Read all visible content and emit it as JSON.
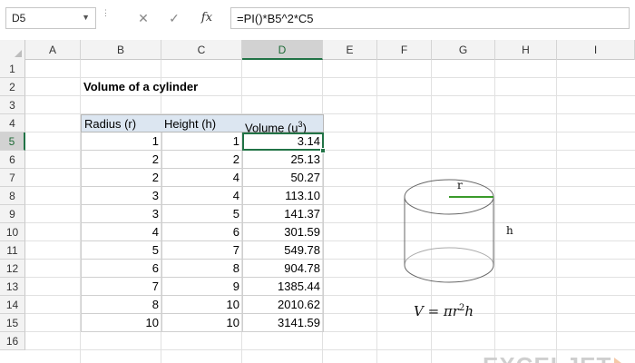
{
  "formula_bar": {
    "name_box": "D5",
    "cancel_glyph": "✕",
    "enter_glyph": "✓",
    "fx_label": "fx",
    "formula": "=PI()*B5^2*C5"
  },
  "columns": [
    "A",
    "B",
    "C",
    "D",
    "E",
    "F",
    "G",
    "H",
    "I"
  ],
  "active_column": "D",
  "rows": [
    "1",
    "2",
    "3",
    "4",
    "5",
    "6",
    "7",
    "8",
    "9",
    "10",
    "11",
    "12",
    "13",
    "14",
    "15",
    "16"
  ],
  "active_row": "5",
  "sheet": {
    "title": "Volume of a cylinder",
    "headers": {
      "radius": "Radius (r)",
      "height": "Height (h)",
      "volume": "Volume (u",
      "volume_sup": "3",
      "volume_end": ")"
    },
    "table": [
      {
        "r": "1",
        "h": "1",
        "v": "3.14"
      },
      {
        "r": "2",
        "h": "2",
        "v": "25.13"
      },
      {
        "r": "2",
        "h": "4",
        "v": "50.27"
      },
      {
        "r": "3",
        "h": "4",
        "v": "113.10"
      },
      {
        "r": "3",
        "h": "5",
        "v": "141.37"
      },
      {
        "r": "4",
        "h": "6",
        "v": "301.59"
      },
      {
        "r": "5",
        "h": "7",
        "v": "549.78"
      },
      {
        "r": "6",
        "h": "8",
        "v": "904.78"
      },
      {
        "r": "7",
        "h": "9",
        "v": "1385.44"
      },
      {
        "r": "8",
        "h": "10",
        "v": "2010.62"
      },
      {
        "r": "10",
        "h": "10",
        "v": "3141.59"
      }
    ]
  },
  "illustration": {
    "radius_label": "r",
    "height_label": "h",
    "formula_v": "V = πr",
    "formula_sup": "2",
    "formula_h": "h",
    "radius_color": "#3a9a2a"
  },
  "watermark": {
    "text": "EXCELJET"
  },
  "colors": {
    "accent": "#217346",
    "header_fill": "#dce6f1"
  }
}
